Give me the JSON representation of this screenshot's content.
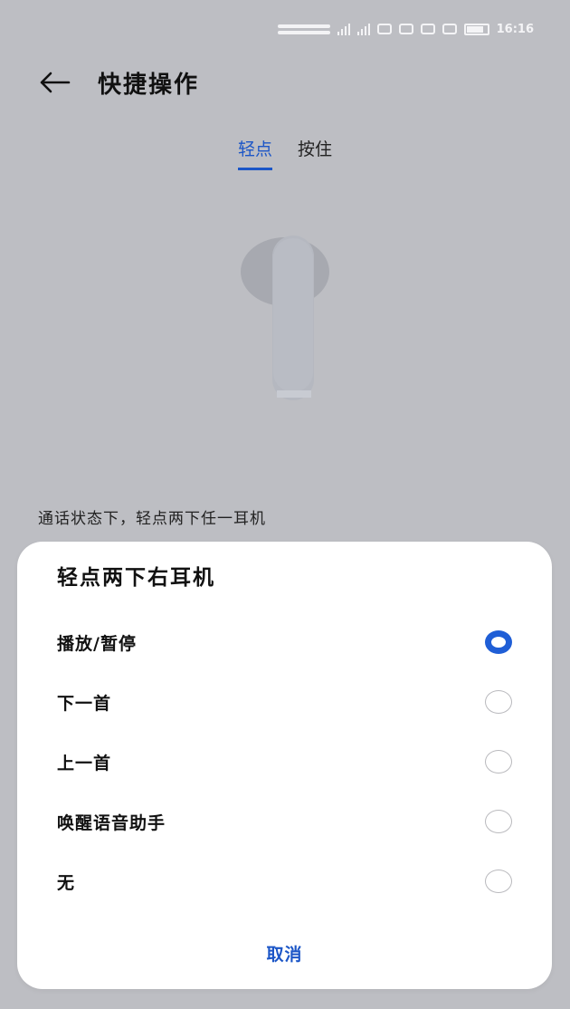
{
  "status_bar": {
    "time": "16:16"
  },
  "header": {
    "title": "快捷操作"
  },
  "tabs": [
    {
      "label": "轻点",
      "active": true
    },
    {
      "label": "按住",
      "active": false
    }
  ],
  "description": "通话状态下，轻点两下任一耳机",
  "sheet": {
    "title": "轻点两下右耳机",
    "options": [
      {
        "label": "播放/暂停",
        "selected": true
      },
      {
        "label": "下一首",
        "selected": false
      },
      {
        "label": "上一首",
        "selected": false
      },
      {
        "label": "唤醒语音助手",
        "selected": false
      },
      {
        "label": "无",
        "selected": false
      }
    ],
    "cancel_label": "取消"
  },
  "colors": {
    "accent": "#1c56c7",
    "overlay": "#bdbec3",
    "sheet": "#ffffff"
  }
}
